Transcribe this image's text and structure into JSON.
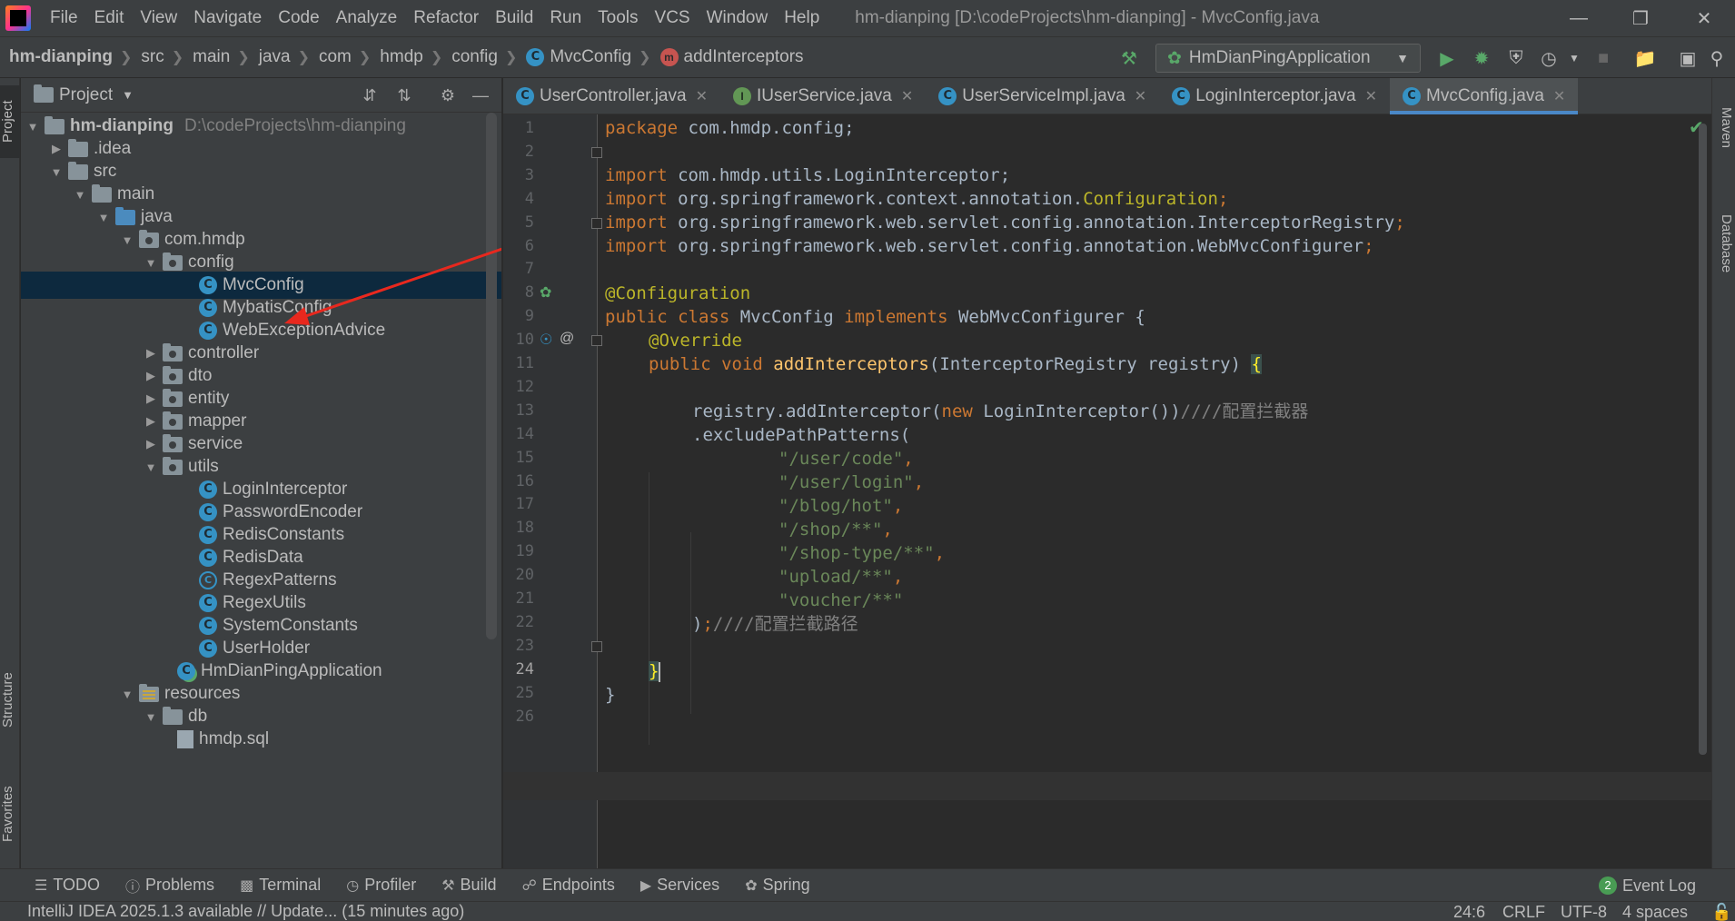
{
  "menubar": {
    "items": [
      "File",
      "Edit",
      "View",
      "Navigate",
      "Code",
      "Analyze",
      "Refactor",
      "Build",
      "Run",
      "Tools",
      "VCS",
      "Window",
      "Help"
    ],
    "title": "hm-dianping [D:\\codeProjects\\hm-dianping] - MvcConfig.java"
  },
  "breadcrumb": {
    "items": [
      "hm-dianping",
      "src",
      "main",
      "java",
      "com",
      "hmdp",
      "config",
      "MvcConfig",
      "addInterceptors"
    ]
  },
  "run_config": {
    "label": "HmDianPingApplication"
  },
  "left_stripe": {
    "project": "Project",
    "structure": "Structure",
    "favorites": "Favorites"
  },
  "right_stripe": {
    "maven": "Maven",
    "database": "Database"
  },
  "project_panel": {
    "title": "Project",
    "tree": [
      {
        "label": "hm-dianping",
        "hint": "D:\\codeProjects\\hm-dianping"
      },
      {
        "label": ".idea"
      },
      {
        "label": "src"
      },
      {
        "label": "main"
      },
      {
        "label": "java"
      },
      {
        "label": "com.hmdp"
      },
      {
        "label": "config"
      },
      {
        "label": "MvcConfig"
      },
      {
        "label": "MybatisConfig"
      },
      {
        "label": "WebExceptionAdvice"
      },
      {
        "label": "controller"
      },
      {
        "label": "dto"
      },
      {
        "label": "entity"
      },
      {
        "label": "mapper"
      },
      {
        "label": "service"
      },
      {
        "label": "utils"
      },
      {
        "label": "LoginInterceptor"
      },
      {
        "label": "PasswordEncoder"
      },
      {
        "label": "RedisConstants"
      },
      {
        "label": "RedisData"
      },
      {
        "label": "RegexPatterns"
      },
      {
        "label": "RegexUtils"
      },
      {
        "label": "SystemConstants"
      },
      {
        "label": "UserHolder"
      },
      {
        "label": "HmDianPingApplication"
      },
      {
        "label": "resources"
      },
      {
        "label": "db"
      },
      {
        "label": "hmdp.sql"
      }
    ]
  },
  "tabs": [
    {
      "label": "UserController.java"
    },
    {
      "label": "IUserService.java"
    },
    {
      "label": "UserServiceImpl.java"
    },
    {
      "label": "LoginInterceptor.java"
    },
    {
      "label": "MvcConfig.java"
    }
  ],
  "editor": {
    "line_numbers": [
      "1",
      "2",
      "3",
      "4",
      "5",
      "6",
      "7",
      "8",
      "9",
      "10",
      "11",
      "12",
      "13",
      "14",
      "15",
      "16",
      "17",
      "18",
      "19",
      "20",
      "21",
      "22",
      "23",
      "24",
      "25",
      "26"
    ],
    "code": {
      "l1_kw": "package",
      "l1_rest": " com.hmdp.config;",
      "l3_kw": "import",
      "l3_rest": " com.hmdp.utils.LoginInterceptor;",
      "l4_kw": "import",
      "l4_rest": " org.springframework.context.annotation.",
      "l4_cls": "Configuration",
      "l4_end": ";",
      "l5_kw": "import",
      "l5_rest": " org.springframework.web.servlet.config.annotation.InterceptorRegistry",
      "l5_end": ";",
      "l6_kw": "import",
      "l6_rest": " org.springframework.web.servlet.config.annotation.WebMvcConfigurer",
      "l6_end": ";",
      "l8_ann": "@Configuration",
      "l9_kw1": "public class",
      "l9_mid": " MvcConfig ",
      "l9_kw2": "implements",
      "l9_rest": " WebMvcConfigurer {",
      "l10_ann": "@Override",
      "l11_kw": "public void",
      "l11_fn": " addInterceptors",
      "l11_rest": "(InterceptorRegistry registry) ",
      "l11_brace": "{",
      "l13_a": "registry.addInterceptor(",
      "l13_kw": "new",
      "l13_b": " LoginInterceptor())",
      "l13_cm": "////配置拦截器",
      "l14": ".excludePathPatterns(",
      "l15": "\"/user/code\"",
      "l16": "\"/user/login\"",
      "l17": "\"/blog/hot\"",
      "l18": "\"/shop/**\"",
      "l19": "\"/shop-type/**\"",
      "l20": "\"upload/**\"",
      "l21": "\"voucher/**\"",
      "l22_a": ")",
      "l22_semi": ";",
      "l22_cm": "////配置拦截路径",
      "l24": "}",
      "l25": "}"
    }
  },
  "bottom_tools": [
    "TODO",
    "Problems",
    "Terminal",
    "Profiler",
    "Build",
    "Endpoints",
    "Services",
    "Spring"
  ],
  "event_log": {
    "count": "2",
    "label": "Event Log"
  },
  "status": {
    "message": "IntelliJ IDEA 2025.1.3 available // Update... (15 minutes ago)",
    "position": "24:6",
    "line_sep": "CRLF",
    "encoding": "UTF-8",
    "indent": "4 spaces"
  }
}
